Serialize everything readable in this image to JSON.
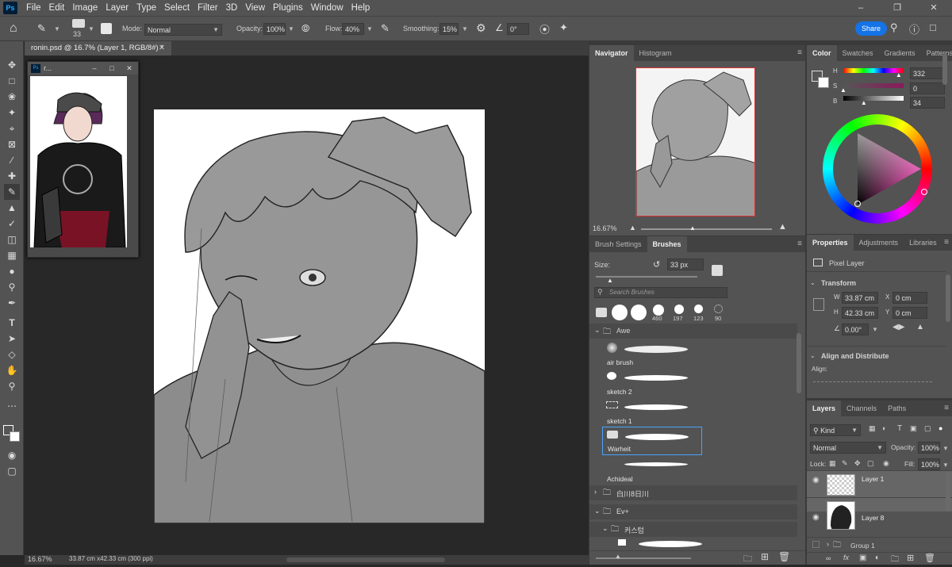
{
  "app": {
    "logo": "Ps",
    "menu": [
      "File",
      "Edit",
      "Image",
      "Layer",
      "Type",
      "Select",
      "Filter",
      "3D",
      "View",
      "Plugins",
      "Window",
      "Help"
    ]
  },
  "options": {
    "brush_size": "33",
    "mode_label": "Mode:",
    "mode_value": "Normal",
    "opacity_label": "Opacity:",
    "opacity_value": "100%",
    "flow_label": "Flow:",
    "flow_value": "40%",
    "smoothing_label": "Smoothing:",
    "smoothing_value": "15%",
    "angle_value": "0°",
    "share_label": "Share"
  },
  "document": {
    "tab_title": "ronin.psd @ 16.7% (Layer 1, RGB/8#) *",
    "zoom": "16.67%",
    "dimensions": "33.87 cm x42.33 cm (300 ppi)"
  },
  "float_window": {
    "title": "r..."
  },
  "navigator": {
    "tabs": [
      "Navigator",
      "Histogram"
    ],
    "zoom": "16.67%"
  },
  "color": {
    "tabs": [
      "Color",
      "Swatches",
      "Gradients",
      "Patterns"
    ],
    "h_label": "H",
    "h_value": "332",
    "s_label": "S",
    "s_value": "0",
    "b_label": "B",
    "b_value": "34",
    "h_pct": 0.92,
    "s_pct": 0.0,
    "b_pct": 0.34
  },
  "brushes": {
    "tabs": [
      "Brush Settings",
      "Brushes"
    ],
    "size_label": "Size:",
    "size_value": "33 px",
    "search_placeholder": "Search Brushes",
    "recent_sizes": [
      "460",
      "197",
      "123",
      "90"
    ],
    "group_awe": "Awe",
    "items": [
      {
        "name": "air brush"
      },
      {
        "name": "sketch 2"
      },
      {
        "name": "sketch 1"
      },
      {
        "name": "Warheit"
      },
      {
        "name": "Achideal"
      }
    ],
    "folders": [
      "白川8日川",
      "Ev+",
      "커스텀"
    ]
  },
  "properties": {
    "tabs": [
      "Properties",
      "Adjustments",
      "Libraries"
    ],
    "kind": "Pixel Layer",
    "transform_label": "Transform",
    "w_label": "W",
    "w_value": "33.87 cm",
    "h_label": "H",
    "h_value": "42.33 cm",
    "x_label": "X",
    "x_value": "0 cm",
    "y_label": "Y",
    "y_value": "0 cm",
    "angle_value": "0.00°",
    "align_label": "Align and Distribute",
    "align_sub": "Align:"
  },
  "layers": {
    "tabs": [
      "Layers",
      "Channels",
      "Paths"
    ],
    "filter_kind": "Kind",
    "blend": "Normal",
    "opacity_label": "Opacity:",
    "opacity_value": "100%",
    "lock_label": "Lock:",
    "fill_label": "Fill:",
    "fill_value": "100%",
    "items": [
      {
        "name": "Layer 1"
      },
      {
        "name": "Layer 8"
      },
      {
        "name": "Group 1"
      }
    ]
  }
}
